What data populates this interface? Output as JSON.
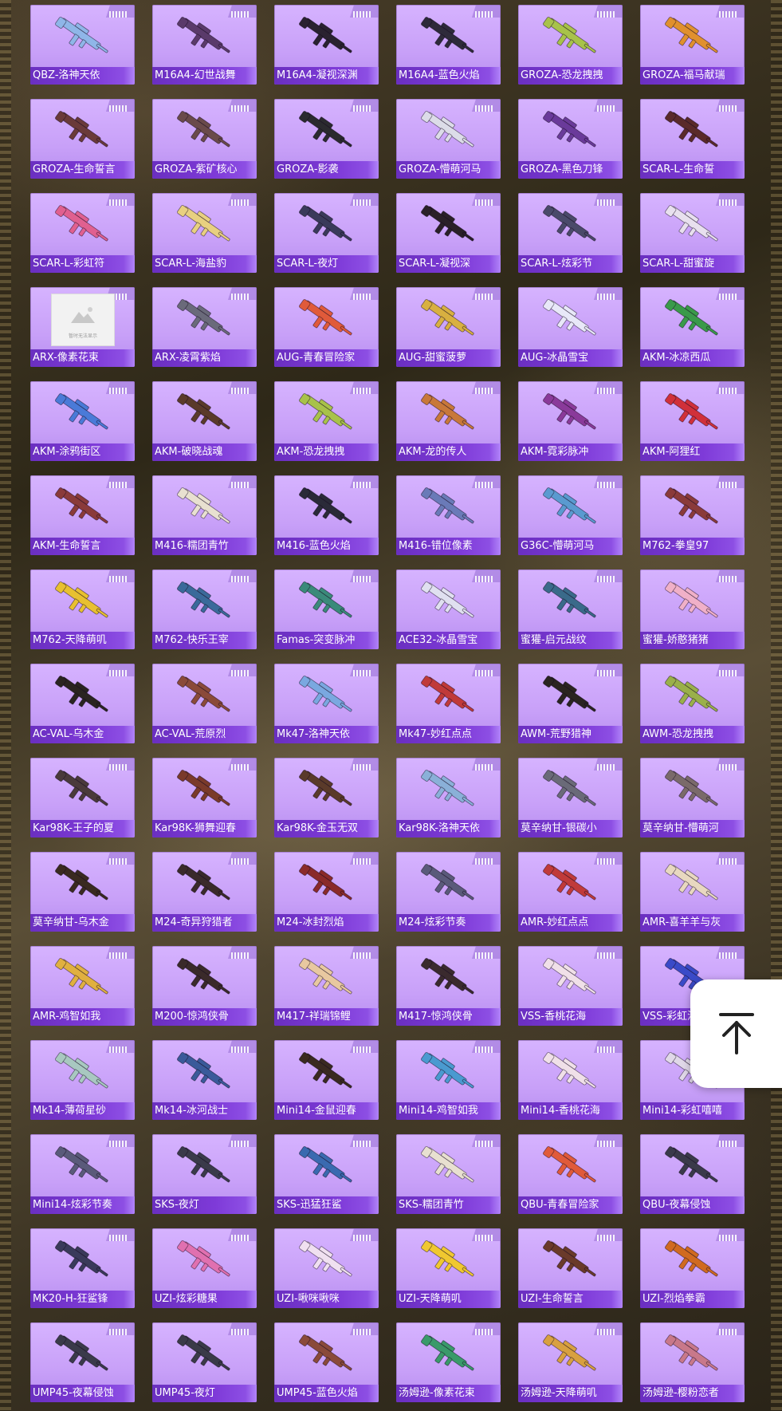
{
  "top_button": {
    "icon": "arrow-up-to-top-icon"
  },
  "image_placeholder_text": "暂时无法显示",
  "items": [
    {
      "label": "QBZ-洛神天依",
      "color": "#8fb6e8"
    },
    {
      "label": "M16A4-幻世战舞",
      "color": "#5a3a6a"
    },
    {
      "label": "M16A4-凝视深渊",
      "color": "#2a2230"
    },
    {
      "label": "M16A4-蓝色火焰",
      "color": "#2e2a3a"
    },
    {
      "label": "GROZA-恐龙拽拽",
      "color": "#a8c24a"
    },
    {
      "label": "GROZA-福马献瑞",
      "color": "#e0902e"
    },
    {
      "label": "GROZA-生命誓言",
      "color": "#6a3a3a"
    },
    {
      "label": "GROZA-紫矿核心",
      "color": "#6a4a4a"
    },
    {
      "label": "GROZA-影袭",
      "color": "#2a2a2e"
    },
    {
      "label": "GROZA-懵萌河马",
      "color": "#dcdce8"
    },
    {
      "label": "GROZA-黑色刀锋",
      "color": "#6a3a9a"
    },
    {
      "label": "SCAR-L-生命誓",
      "color": "#5a2a2a"
    },
    {
      "label": "SCAR-L-彩虹符",
      "color": "#e06090"
    },
    {
      "label": "SCAR-L-海盐豹",
      "color": "#e8d080"
    },
    {
      "label": "SCAR-L-夜灯",
      "color": "#3a3a5a"
    },
    {
      "label": "SCAR-L-凝视深",
      "color": "#2a2028"
    },
    {
      "label": "SCAR-L-炫彩节",
      "color": "#4a4a6a"
    },
    {
      "label": "SCAR-L-甜蜜旋",
      "color": "#e8e0ee"
    },
    {
      "label": "ARX-像素花束",
      "color": "",
      "placeholder": true
    },
    {
      "label": "ARX-凌霄紫焰",
      "color": "#6a6a7a"
    },
    {
      "label": "AUG-青春冒险家",
      "color": "#e05a3a"
    },
    {
      "label": "AUG-甜蜜菠萝",
      "color": "#d8b040"
    },
    {
      "label": "AUG-冰晶雪宝",
      "color": "#e8e8f8"
    },
    {
      "label": "AKM-冰凉西瓜",
      "color": "#3a9a4a"
    },
    {
      "label": "AKM-涂鸦街区",
      "color": "#4a7ad8"
    },
    {
      "label": "AKM-破晓战魂",
      "color": "#5a3a2a"
    },
    {
      "label": "AKM-恐龙拽拽",
      "color": "#a8c24a"
    },
    {
      "label": "AKM-龙的传人",
      "color": "#c8783a"
    },
    {
      "label": "AKM-霓彩脉冲",
      "color": "#8a3a9a"
    },
    {
      "label": "AKM-阿狸红",
      "color": "#d0303a"
    },
    {
      "label": "AKM-生命誓言",
      "color": "#8a3a3a"
    },
    {
      "label": "M416-糯团青竹",
      "color": "#e8e0d0"
    },
    {
      "label": "M416-蓝色火焰",
      "color": "#2a2a38"
    },
    {
      "label": "M416-错位像素",
      "color": "#6a7ab8"
    },
    {
      "label": "G36C-懵萌河马",
      "color": "#5a9ad0"
    },
    {
      "label": "M762-拳皇97",
      "color": "#8a3a3a"
    },
    {
      "label": "M762-天降萌叽",
      "color": "#e8c030"
    },
    {
      "label": "M762-快乐王宰",
      "color": "#3a6a9a"
    },
    {
      "label": "Famas-突变脉冲",
      "color": "#3a8a7a"
    },
    {
      "label": "ACE32-冰晶雪宝",
      "color": "#e0e0f0"
    },
    {
      "label": "蜜獾-启元战纹",
      "color": "#3a6a8a"
    },
    {
      "label": "蜜獾-娇憨猪猪",
      "color": "#f0b0c8"
    },
    {
      "label": "AC-VAL-乌木金",
      "color": "#2a2420"
    },
    {
      "label": "AC-VAL-荒原烈",
      "color": "#8a4a3a"
    },
    {
      "label": "Mk47-洛神天依",
      "color": "#7aa8e0"
    },
    {
      "label": "Mk47-妙红点点",
      "color": "#c03a3a"
    },
    {
      "label": "AWM-荒野猎神",
      "color": "#2a2420"
    },
    {
      "label": "AWM-恐龙拽拽",
      "color": "#9ab04a"
    },
    {
      "label": "Kar98K-王子的夏",
      "color": "#4a3a3a"
    },
    {
      "label": "Kar98K-狮舞迎春",
      "color": "#7a3a2a"
    },
    {
      "label": "Kar98K-金玉无双",
      "color": "#5a3a2a"
    },
    {
      "label": "Kar98K-洛神天依",
      "color": "#8ab0d8"
    },
    {
      "label": "莫辛纳甘-银碳小",
      "color": "#6a6a78"
    },
    {
      "label": "莫辛纳甘-懵萌河",
      "color": "#7a6a6a"
    },
    {
      "label": "莫辛纳甘-乌木金",
      "color": "#3a2a20"
    },
    {
      "label": "M24-奇异狩猎者",
      "color": "#3a2a2a"
    },
    {
      "label": "M24-冰封烈焰",
      "color": "#8a2a2a"
    },
    {
      "label": "M24-炫彩节奏",
      "color": "#5a5a7a"
    },
    {
      "label": "AMR-妙红点点",
      "color": "#c03a3a"
    },
    {
      "label": "AMR-喜羊羊与灰",
      "color": "#e8d8c0"
    },
    {
      "label": "AMR-鸡智如我",
      "color": "#e0b040"
    },
    {
      "label": "M200-惊鸿侠骨",
      "color": "#3a2a2a"
    },
    {
      "label": "M417-祥瑞锦鲤",
      "color": "#e8c8a0"
    },
    {
      "label": "M417-惊鸿侠骨",
      "color": "#3a2a2e"
    },
    {
      "label": "VSS-香桃花海",
      "color": "#f0e0e8"
    },
    {
      "label": "VSS-彩虹泡泡",
      "color": "#3a4ac8"
    },
    {
      "label": "Mk14-薄荷星砂",
      "color": "#a8c8c0"
    },
    {
      "label": "Mk14-冰河战士",
      "color": "#3a5a9a"
    },
    {
      "label": "Mini14-金鼠迎春",
      "color": "#3a2a20"
    },
    {
      "label": "Mini14-鸡智如我",
      "color": "#4a9ad0"
    },
    {
      "label": "Mini14-香桃花海",
      "color": "#f0e0e8"
    },
    {
      "label": "Mini14-彩虹嘻嘻",
      "color": "#e0d8e8"
    },
    {
      "label": "Mini14-炫彩节奏",
      "color": "#5a5a7a"
    },
    {
      "label": "SKS-夜灯",
      "color": "#3a3a4a"
    },
    {
      "label": "SKS-迅猛狂鲨",
      "color": "#3a6ab0"
    },
    {
      "label": "SKS-糯团青竹",
      "color": "#e8e0d0"
    },
    {
      "label": "QBU-青春冒险家",
      "color": "#e05a3a"
    },
    {
      "label": "QBU-夜幕侵蚀",
      "color": "#3a3a4a"
    },
    {
      "label": "MK20-H-狂鲨锋",
      "color": "#3a3a5a"
    },
    {
      "label": "UZI-炫彩糖果",
      "color": "#e070b0"
    },
    {
      "label": "UZI-啾咪啾咪",
      "color": "#f0e0f0"
    },
    {
      "label": "UZI-天降萌叽",
      "color": "#f0c830"
    },
    {
      "label": "UZI-生命誓言",
      "color": "#6a3a2a"
    },
    {
      "label": "UZI-烈焰拳霸",
      "color": "#d06a20"
    },
    {
      "label": "UMP45-夜幕侵蚀",
      "color": "#3a3a4a"
    },
    {
      "label": "UMP45-夜灯",
      "color": "#3a3a48"
    },
    {
      "label": "UMP45-蓝色火焰",
      "color": "#8a4a3a"
    },
    {
      "label": "汤姆逊-像素花束",
      "color": "#3a9a6a"
    },
    {
      "label": "汤姆逊-天降萌叽",
      "color": "#d8a040"
    },
    {
      "label": "汤姆逊-樱粉恋者",
      "color": "#c8788a"
    }
  ]
}
